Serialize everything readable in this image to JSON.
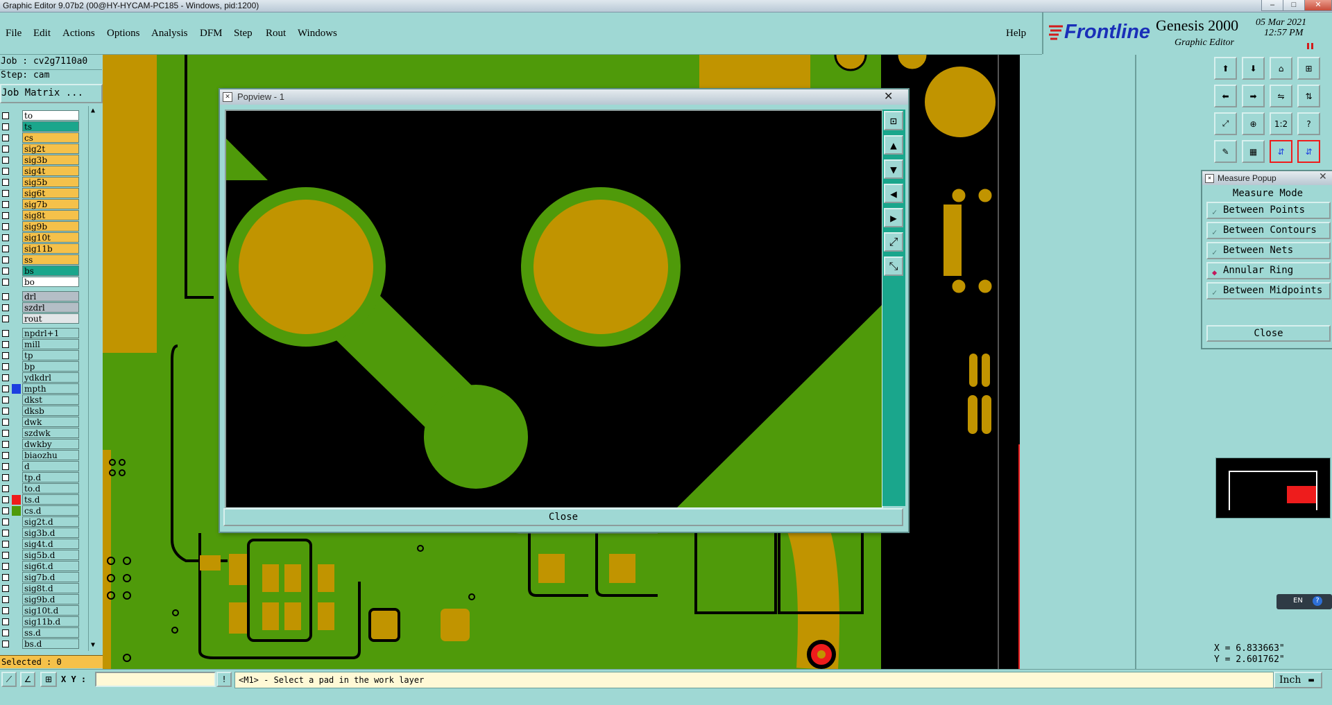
{
  "window": {
    "title": "Graphic Editor 9.07b2 (00@HY-HYCAM-PC185 - Windows, pid:1200)",
    "minimize": "–",
    "maximize": "□",
    "close": "✕"
  },
  "menu": [
    "File",
    "Edit",
    "Actions",
    "Options",
    "Analysis",
    "DFM",
    "Step",
    "Rout",
    "Windows"
  ],
  "help": "Help",
  "brand": {
    "logo": "Frontline",
    "product": "Genesis 2000",
    "subtitle": "Graphic Editor",
    "date": "05 Mar 2021",
    "time": "12:57 PM"
  },
  "job": {
    "job_line": "Job : cv2g7110a0",
    "step_line": "Step: cam",
    "matrix_button": "Job Matrix ..."
  },
  "layers_group1": [
    {
      "name": "to",
      "color": "#ffffff"
    },
    {
      "name": "ts",
      "color": "#1aa68c"
    },
    {
      "name": "cs",
      "color": "#f5c14a"
    },
    {
      "name": "sig2t",
      "color": "#f5c14a"
    },
    {
      "name": "sig3b",
      "color": "#f5c14a"
    },
    {
      "name": "sig4t",
      "color": "#f5c14a"
    },
    {
      "name": "sig5b",
      "color": "#f5c14a"
    },
    {
      "name": "sig6t",
      "color": "#f5c14a"
    },
    {
      "name": "sig7b",
      "color": "#f5c14a"
    },
    {
      "name": "sig8t",
      "color": "#f5c14a"
    },
    {
      "name": "sig9b",
      "color": "#f5c14a"
    },
    {
      "name": "sig10t",
      "color": "#f5c14a"
    },
    {
      "name": "sig11b",
      "color": "#f5c14a"
    },
    {
      "name": "ss",
      "color": "#f5c14a"
    },
    {
      "name": "bs",
      "color": "#1aa68c"
    },
    {
      "name": "bo",
      "color": "#ffffff"
    }
  ],
  "layers_group2": [
    {
      "name": "drl",
      "color": "#b4bec6"
    },
    {
      "name": "szdrl",
      "color": "#b4bec6"
    },
    {
      "name": "rout",
      "color": "#e2e6e8"
    }
  ],
  "layers_group3": [
    {
      "name": "npdrl+1",
      "color": "#9fd8d4",
      "swatch": ""
    },
    {
      "name": "mill",
      "color": "#9fd8d4",
      "swatch": ""
    },
    {
      "name": "tp",
      "color": "#9fd8d4",
      "swatch": ""
    },
    {
      "name": "bp",
      "color": "#9fd8d4",
      "swatch": ""
    },
    {
      "name": "ydkdrl",
      "color": "#9fd8d4",
      "swatch": ""
    },
    {
      "name": "mpth",
      "color": "#9fd8d4",
      "swatch": "#1d3fe0"
    },
    {
      "name": "dkst",
      "color": "#9fd8d4",
      "swatch": ""
    },
    {
      "name": "dksb",
      "color": "#9fd8d4",
      "swatch": ""
    },
    {
      "name": "dwk",
      "color": "#9fd8d4",
      "swatch": ""
    },
    {
      "name": "szdwk",
      "color": "#9fd8d4",
      "swatch": ""
    },
    {
      "name": "dwkby",
      "color": "#9fd8d4",
      "swatch": ""
    },
    {
      "name": "biaozhu",
      "color": "#9fd8d4",
      "swatch": ""
    },
    {
      "name": "d",
      "color": "#9fd8d4",
      "swatch": ""
    },
    {
      "name": "tp.d",
      "color": "#9fd8d4",
      "swatch": ""
    },
    {
      "name": "to.d",
      "color": "#9fd8d4",
      "swatch": ""
    },
    {
      "name": "ts.d",
      "color": "#9fd8d4",
      "swatch": "#ee1c1c"
    },
    {
      "name": "cs.d",
      "color": "#9fd8d4",
      "swatch": "#4f9a0a"
    },
    {
      "name": "sig2t.d",
      "color": "#9fd8d4",
      "swatch": ""
    },
    {
      "name": "sig3b.d",
      "color": "#9fd8d4",
      "swatch": ""
    },
    {
      "name": "sig4t.d",
      "color": "#9fd8d4",
      "swatch": ""
    },
    {
      "name": "sig5b.d",
      "color": "#9fd8d4",
      "swatch": ""
    },
    {
      "name": "sig6t.d",
      "color": "#9fd8d4",
      "swatch": ""
    },
    {
      "name": "sig7b.d",
      "color": "#9fd8d4",
      "swatch": ""
    },
    {
      "name": "sig8t.d",
      "color": "#9fd8d4",
      "swatch": ""
    },
    {
      "name": "sig9b.d",
      "color": "#9fd8d4",
      "swatch": ""
    },
    {
      "name": "sig10t.d",
      "color": "#9fd8d4",
      "swatch": ""
    },
    {
      "name": "sig11b.d",
      "color": "#9fd8d4",
      "swatch": ""
    },
    {
      "name": "ss.d",
      "color": "#9fd8d4",
      "swatch": ""
    },
    {
      "name": "bs.d",
      "color": "#9fd8d4",
      "swatch": ""
    }
  ],
  "selected_text": "Selected : 0",
  "popview": {
    "title": "Popview - 1",
    "close_label": "Close"
  },
  "measure_popup": {
    "title": "Measure Popup",
    "header": "Measure Mode",
    "modes": [
      {
        "label": "Between Points",
        "active": false
      },
      {
        "label": "Between Contours",
        "active": false
      },
      {
        "label": "Between Nets",
        "active": false
      },
      {
        "label": "Annular Ring",
        "active": true
      },
      {
        "label": "Between Midpoints",
        "active": false
      }
    ],
    "close_label": "Close"
  },
  "toolbar_right": [
    "1:2",
    "?"
  ],
  "coords": {
    "x": "X = 6.833663\"",
    "y": "Y = 2.601762\""
  },
  "ime": "EN",
  "status": {
    "xy_label": "X Y :",
    "xy_value": "",
    "message": "<M1> - Select a pad in the work layer",
    "units": "Inch"
  },
  "colors": {
    "panel": "#9fd8d4",
    "copper": "#c19400",
    "board": "#4f9a0a",
    "background": "#000000",
    "highlight": "#ee1c1c"
  }
}
